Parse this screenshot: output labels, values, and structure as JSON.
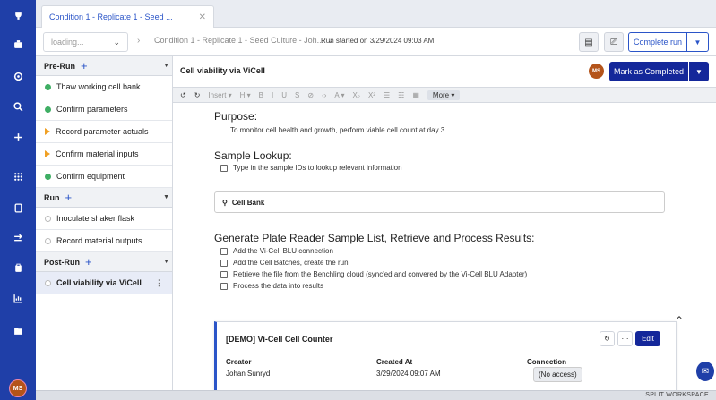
{
  "nav": {
    "avatar": "MS",
    "icons": [
      "trophy-icon",
      "briefcase-icon",
      "settings-icon",
      "search-icon",
      "plus-icon",
      "apps-icon",
      "notebook-icon",
      "flow-icon",
      "clipboard-icon",
      "chart-icon",
      "folder-icon"
    ]
  },
  "tab": {
    "label": "Condition 1 - Replicate 1 - Seed ...",
    "close": "✕"
  },
  "toolbar": {
    "loading": "loading...",
    "crumb": "Condition 1 - Replicate 1 - Seed Culture - Joh...",
    "run_started": "Run started on 3/29/2024 09:03 AM",
    "complete_label": "Complete run"
  },
  "sidebar": {
    "sections": [
      {
        "title": "Pre-Run",
        "items": [
          {
            "label": "Thaw working cell bank",
            "status": "done"
          },
          {
            "label": "Confirm parameters",
            "status": "done"
          },
          {
            "label": "Record parameter actuals",
            "status": "warn"
          },
          {
            "label": "Confirm material inputs",
            "status": "warn"
          },
          {
            "label": "Confirm equipment",
            "status": "done"
          }
        ]
      },
      {
        "title": "Run",
        "items": [
          {
            "label": "Inoculate shaker flask",
            "status": "open"
          },
          {
            "label": "Record material outputs",
            "status": "open"
          }
        ]
      },
      {
        "title": "Post-Run",
        "items": [
          {
            "label": "Cell viability via ViCell",
            "status": "open",
            "active": true
          }
        ]
      }
    ]
  },
  "entry": {
    "title": "Cell viability via ViCell",
    "avatar": "MS",
    "mark_label": "Mark as Completed",
    "format_bar": [
      "↺",
      "↻",
      "Insert ▾",
      "H ▾",
      "B",
      "I",
      "U",
      "S",
      "⊘",
      "‹›",
      "A ▾",
      "X₂",
      "X²",
      "☰",
      "☷",
      "▦"
    ],
    "more": "More ▾"
  },
  "doc": {
    "purpose_heading": "Purpose:",
    "purpose_text": "To monitor cell health and growth, perform viable cell count at day 3",
    "lookup_heading": "Sample Lookup:",
    "lookup_check": "Type in the sample IDs to lookup relevant information",
    "search_value": "Cell Bank",
    "generate_heading": "Generate Plate Reader Sample List, Retrieve and Process Results:",
    "checks": [
      "Add the Vi-Cell BLU connection",
      "Add the Cell Batches, create the run",
      "Retrieve the file from the Benchling cloud (sync'ed and convered by the Vi-Cell BLU Adapter)",
      "Process the data into results"
    ]
  },
  "card": {
    "title": "[DEMO] Vi-Cell Cell Counter",
    "edit": "Edit",
    "creator_label": "Creator",
    "creator_value": "Johan Sunryd",
    "created_label": "Created At",
    "created_value": "3/29/2024 09:07 AM",
    "connection_label": "Connection",
    "connection_value": "(No access)"
  },
  "status_bar": {
    "split": "SPLIT WORKSPACE"
  }
}
